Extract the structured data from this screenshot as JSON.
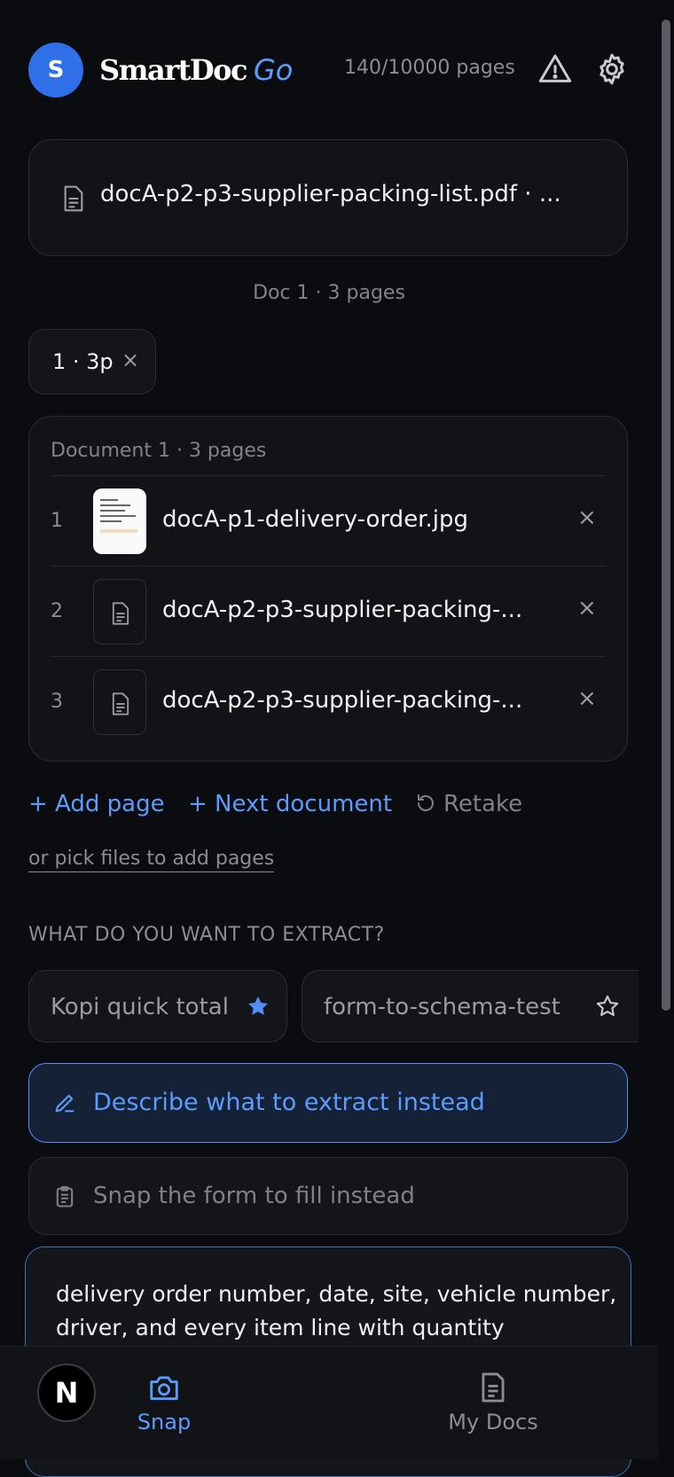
{
  "header": {
    "avatar_letter": "S",
    "brand_main": "SmartDoc",
    "brand_accent": "Go",
    "quota": "140/10000 pages"
  },
  "current_file": {
    "name": "docA-p2-p3-supplier-packing-list.pdf · ..."
  },
  "doc_summary": "Doc 1 · 3 pages",
  "chips": [
    {
      "label": "1 · 3p",
      "close": "×"
    }
  ],
  "document": {
    "header": "Document 1 · 3 pages",
    "pages": [
      {
        "num": "1",
        "name": "docA-p1-delivery-order.jpg",
        "thumb": "image",
        "close": "×"
      },
      {
        "num": "2",
        "name": "docA-p2-p3-supplier-packing-...",
        "thumb": "file",
        "close": "×"
      },
      {
        "num": "3",
        "name": "docA-p2-p3-supplier-packing-...",
        "thumb": "file",
        "close": "×"
      }
    ]
  },
  "actions": {
    "add_page": "+ Add page",
    "next_document": "+ Next document",
    "retake": "Retake",
    "pick_files": "or pick files to add pages"
  },
  "extract": {
    "section_title": "WHAT DO YOU WANT TO EXTRACT?",
    "templates": [
      {
        "label": "Kopi quick total",
        "starred": true
      },
      {
        "label": "form-to-schema-test",
        "starred": false
      }
    ],
    "describe_label": "Describe what to extract instead",
    "snap_form_label": "Snap the form to fill instead",
    "prompt_text": "delivery order number, date, site, vehicle number, driver, and every item line with quantity"
  },
  "bottom_nav": {
    "n_badge": "N",
    "tabs": [
      {
        "label": "Snap",
        "active": true
      },
      {
        "label": "My Docs",
        "active": false
      }
    ]
  },
  "colors": {
    "accent": "#5b9cff",
    "background": "#0b0c0f",
    "card": "#121317"
  }
}
